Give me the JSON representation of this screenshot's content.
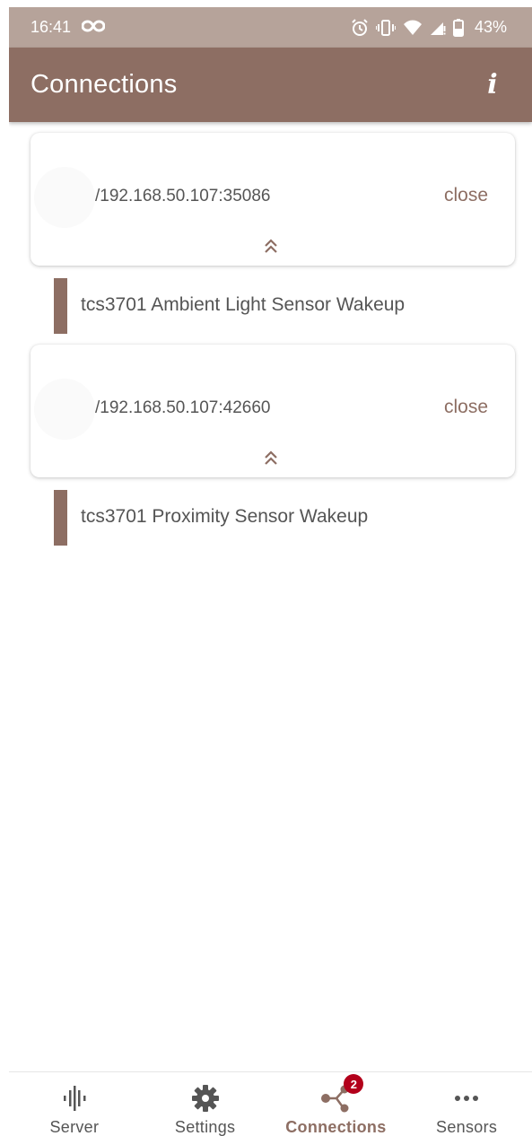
{
  "status_bar": {
    "time": "16:41",
    "infinity_icon": "infinity-icon",
    "battery_percent": "43%",
    "icons": [
      "alarm-icon",
      "vibrate-icon",
      "wifi-icon",
      "signal-icon",
      "battery-icon"
    ]
  },
  "app_bar": {
    "title": "Connections",
    "info_label": "i"
  },
  "connections": [
    {
      "address": "/192.168.50.107:35086",
      "close_label": "close",
      "sensor": "tcs3701 Ambient Light Sensor Wakeup"
    },
    {
      "address": "/192.168.50.107:42660",
      "close_label": "close",
      "sensor": "tcs3701 Proximity Sensor Wakeup"
    }
  ],
  "bottom_nav": {
    "items": [
      {
        "label": "Server",
        "icon": "waveform-icon",
        "active": false
      },
      {
        "label": "Settings",
        "icon": "gear-icon",
        "active": false
      },
      {
        "label": "Connections",
        "icon": "connections-icon",
        "active": true,
        "badge": "2"
      },
      {
        "label": "Sensors",
        "icon": "more-horizontal-icon",
        "active": false
      }
    ]
  },
  "colors": {
    "primary": "#8d6e63",
    "status_bar": "#b6a39a",
    "badge": "#b3001b",
    "text": "#555555"
  }
}
